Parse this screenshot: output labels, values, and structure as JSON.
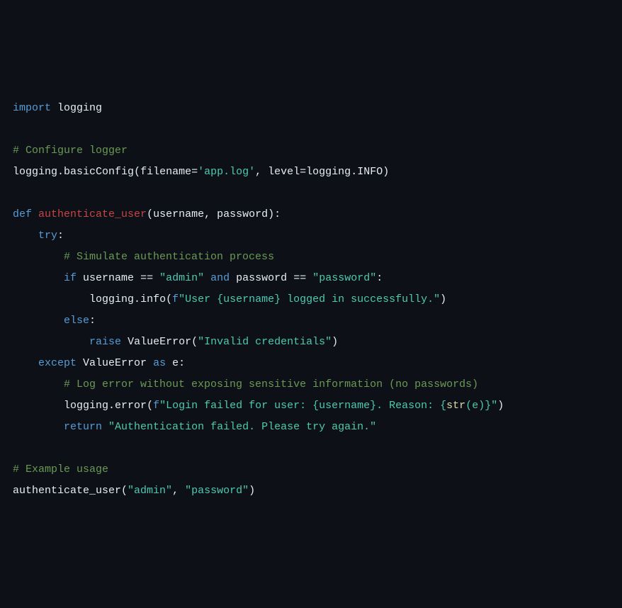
{
  "code": {
    "l1_import": "import",
    "l1_logging": "logging",
    "l3_comment": "# Configure logger",
    "l4_logging": "logging",
    "l4_basicConfig": "basicConfig",
    "l4_filename_kw": "filename",
    "l4_eq": "=",
    "l4_filename_val": "'app.log'",
    "l4_comma": ", ",
    "l4_level_kw": "level",
    "l4_logging2": "logging",
    "l4_INFO": "INFO",
    "l6_def": "def",
    "l6_fname": "authenticate_user",
    "l6_p1": "username",
    "l6_p2": "password",
    "l7_try": "try",
    "l8_comment": "# Simulate authentication process",
    "l9_if": "if",
    "l9_username": "username",
    "l9_eq": "==",
    "l9_admin": "\"admin\"",
    "l9_and": "and",
    "l9_password": "password",
    "l9_passval": "\"password\"",
    "l10_logging": "logging",
    "l10_info": "info",
    "l10_f": "f",
    "l10_str": "\"User {username} logged in successfully.\"",
    "l11_else": "else",
    "l12_raise": "raise",
    "l12_ValueError": "ValueError",
    "l12_msg": "\"Invalid credentials\"",
    "l13_except": "except",
    "l13_ValueError": "ValueError",
    "l13_as": "as",
    "l13_e": "e",
    "l14_comment": "# Log error without exposing sensitive information (no passwords)",
    "l15_logging": "logging",
    "l15_error": "error",
    "l15_f": "f",
    "l15_str1": "\"Login failed for user: {username}. Reason: {",
    "l15_str_func": "str",
    "l15_str2": "(e)}\"",
    "l16_return": "return",
    "l16_msg": "\"Authentication failed. Please try again.\"",
    "l18_comment": "# Example usage",
    "l19_fname": "authenticate_user",
    "l19_admin": "\"admin\"",
    "l19_password": "\"password\""
  }
}
